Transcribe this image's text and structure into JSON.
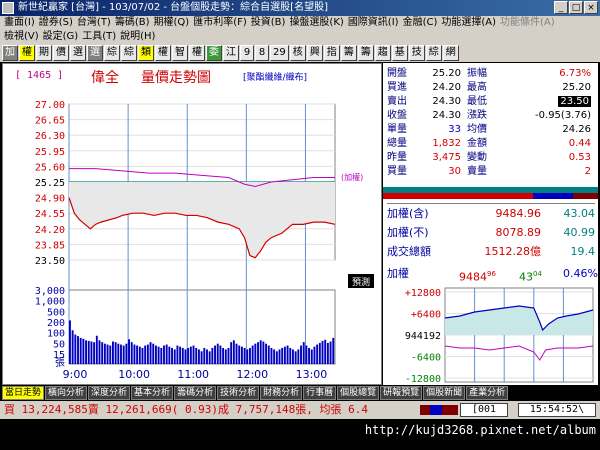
{
  "window": {
    "title": "新世紀贏家 [台灣] - 103/07/02 - 台盤個股走勢：綜合自選股[名望股]"
  },
  "menu": {
    "row1": [
      "畫面(I)",
      "證券(S)",
      "台灣(T)",
      "籌碼(B)",
      "期權(Q)",
      "匯市利率(F)",
      "投資(B)",
      "操盤選股(K)",
      "國際資訊(I)",
      "金融(C)",
      "功能選擇(A)",
      "功能條件(A)"
    ],
    "row2": [
      "檢視(V)",
      "設定(G)",
      "工具(T)",
      "說明(H)"
    ]
  },
  "toolbar": {
    "items": [
      "加",
      "權",
      "期",
      "價",
      "選",
      "選",
      "綜",
      "綜",
      "類",
      "權",
      "智",
      "權",
      "委",
      "江",
      "9",
      "8",
      "29",
      "核",
      "興",
      "指",
      "籌",
      "籌",
      "趨",
      "基",
      "技",
      "綜",
      "網"
    ]
  },
  "header": {
    "code": "[ 1465 ]",
    "name": "偉全",
    "chart_title": "量價走勢圖",
    "sector": "[聚酯纖維/織布]"
  },
  "chart_data": {
    "type": "line",
    "title": "量價走勢圖",
    "price_axis": {
      "ticks": [
        "27.00",
        "26.65",
        "26.30",
        "25.95",
        "25.60",
        "25.25",
        "24.90",
        "24.55",
        "24.20",
        "23.85",
        "23.50"
      ],
      "ylim": [
        23.5,
        27.0
      ]
    },
    "volume_axis": {
      "ticks": [
        "3,000",
        "1,000",
        "500",
        "200",
        "100",
        "50",
        "15"
      ],
      "unit": "張"
    },
    "x_ticks": [
      "9:00",
      "10:00",
      "11:00",
      "12:00",
      "13:00"
    ],
    "reference_label": "(加權)",
    "ref_price": 25.25,
    "price_series": {
      "name": "price",
      "points": [
        [
          0,
          24.9
        ],
        [
          2,
          24.55
        ],
        [
          4,
          24.4
        ],
        [
          6,
          24.3
        ],
        [
          8,
          24.2
        ],
        [
          10,
          24.3
        ],
        [
          12,
          24.35
        ],
        [
          15,
          24.4
        ],
        [
          18,
          24.45
        ],
        [
          20,
          24.5
        ],
        [
          24,
          24.55
        ],
        [
          28,
          24.55
        ],
        [
          32,
          24.5
        ],
        [
          36,
          24.55
        ],
        [
          40,
          24.55
        ],
        [
          44,
          24.5
        ],
        [
          48,
          24.5
        ],
        [
          52,
          24.45
        ],
        [
          56,
          24.35
        ],
        [
          60,
          24.3
        ],
        [
          64,
          24.2
        ],
        [
          66,
          24.0
        ],
        [
          68,
          23.6
        ],
        [
          70,
          23.55
        ],
        [
          72,
          23.7
        ],
        [
          74,
          23.9
        ],
        [
          76,
          24.0
        ],
        [
          80,
          24.1
        ],
        [
          84,
          24.3
        ],
        [
          88,
          24.3
        ],
        [
          92,
          24.35
        ],
        [
          96,
          24.35
        ],
        [
          100,
          24.3
        ]
      ]
    },
    "index_series": {
      "name": "加權",
      "points": [
        [
          0,
          25.55
        ],
        [
          10,
          25.55
        ],
        [
          20,
          25.5
        ],
        [
          30,
          25.45
        ],
        [
          40,
          25.45
        ],
        [
          50,
          25.4
        ],
        [
          60,
          25.35
        ],
        [
          66,
          25.2
        ],
        [
          70,
          25.15
        ],
        [
          76,
          25.25
        ],
        [
          84,
          25.3
        ],
        [
          92,
          25.35
        ],
        [
          100,
          25.35
        ]
      ]
    },
    "volume_series": {
      "name": "volume",
      "values": [
        1650,
        500,
        300,
        250,
        200,
        180,
        150,
        140,
        130,
        120,
        260,
        150,
        120,
        100,
        90,
        80,
        130,
        120,
        100,
        90,
        80,
        100,
        170,
        120,
        90,
        80,
        70,
        60,
        80,
        90,
        120,
        100,
        80,
        70,
        60,
        80,
        90,
        70,
        60,
        50,
        80,
        70,
        60,
        50,
        60,
        70,
        80,
        60,
        50,
        40,
        60,
        50,
        40,
        60,
        80,
        100,
        80,
        60,
        50,
        60,
        120,
        150,
        100,
        80,
        70,
        60,
        50,
        60,
        80,
        100,
        120,
        150,
        130,
        100,
        80,
        60,
        50,
        40,
        50,
        60,
        70,
        80,
        60,
        50,
        40,
        50,
        80,
        120,
        80,
        60,
        50,
        70,
        90,
        110,
        140,
        160,
        110,
        130,
        200
      ]
    }
  },
  "quote": {
    "rows": [
      {
        "l1": "開盤",
        "v1": "25.20",
        "c1": "black",
        "l2": "振幅",
        "v2": "6.73%",
        "c2": "red"
      },
      {
        "l1": "買進",
        "v1": "24.20",
        "c1": "black",
        "l2": "最高",
        "v2": "25.20",
        "c2": "black"
      },
      {
        "l1": "賣出",
        "v1": "24.30",
        "c1": "black",
        "l2": "最低",
        "v2": "23.50",
        "c2": "boxed"
      },
      {
        "l1": "收盤",
        "v1": "24.30",
        "c1": "black",
        "l2": "漲跌",
        "v2": "-0.95(3.76)",
        "c2": "black"
      },
      {
        "l1": "單量",
        "v1": "33",
        "c1": "blue",
        "l2": "均價",
        "v2": "24.26",
        "c2": "black"
      },
      {
        "l1": "總量",
        "v1": "1,832",
        "c1": "red",
        "l2": "金額",
        "v2": "0.44",
        "c2": "red"
      },
      {
        "l1": "昨量",
        "v1": "3,475",
        "c1": "red",
        "l2": "變動",
        "v2": "0.53",
        "c2": "red"
      },
      {
        "l1": "買量",
        "v1": "30",
        "c1": "red",
        "l2": "賣量",
        "v2": "2",
        "c2": "red"
      }
    ]
  },
  "index": {
    "rows": [
      {
        "label": "加權(含)",
        "value": "9484.96",
        "pct": "43.04"
      },
      {
        "label": "加權(不)",
        "value": "8078.89",
        "pct": "40.99"
      },
      {
        "label": "成交總額",
        "value": "1512.28億",
        "pct": "19.4"
      }
    ]
  },
  "mini": {
    "label": "加權",
    "value": "9484",
    "value_dec": "96",
    "change": "43",
    "change_dec": "04",
    "pct": "0.46%",
    "y_ticks": [
      "+12800",
      "+6400",
      "944192",
      "-6400",
      "-12800"
    ]
  },
  "tabs": {
    "items": [
      "當日走勢",
      "橫向分析",
      "深度分析",
      "基本分析",
      "籌碼分析",
      "技術分析",
      "財務分析",
      "行事曆",
      "個股總覽",
      "研報預覽",
      "個股新聞",
      "產業分析"
    ]
  },
  "status": {
    "text": "買 13,224,585賣 12,261,669( 0.93)成 7,757,148張, 均張 6.4",
    "code": "[001",
    "time": "15:54:52\\"
  },
  "watermark": "http://kujd3268.pixnet.net/album",
  "colors": {
    "price": "#d00000",
    "index": "#c000c0",
    "volume": "#0000c0",
    "ref_line": "#008080"
  }
}
